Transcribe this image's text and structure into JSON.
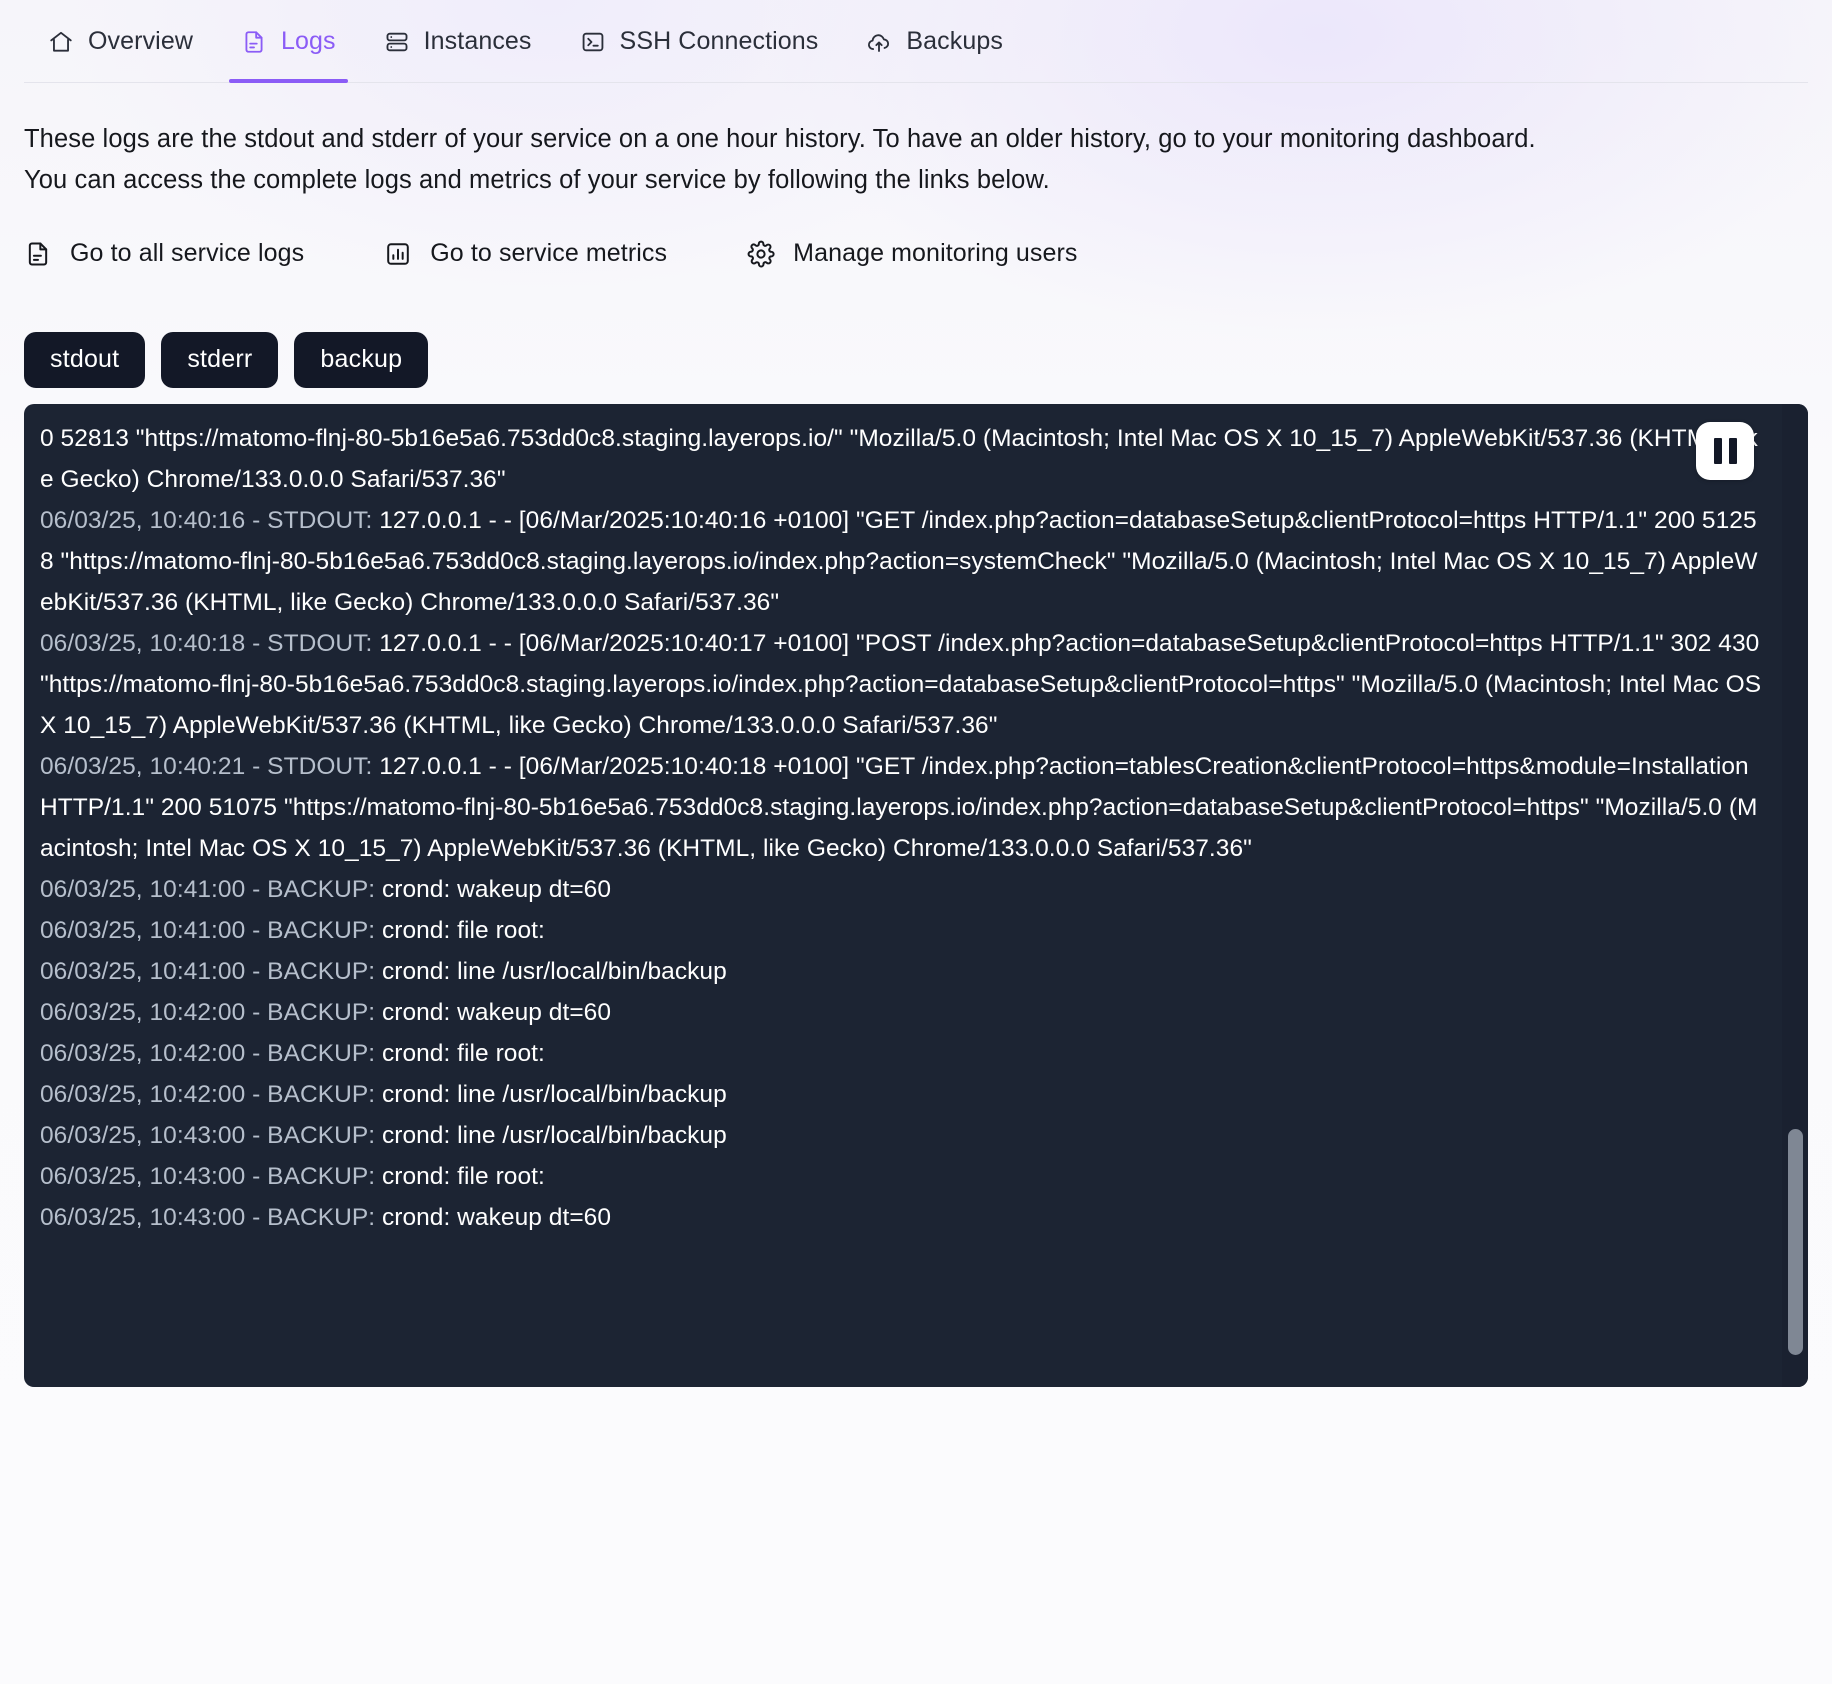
{
  "tabs": [
    {
      "label": "Overview",
      "icon": "home-icon",
      "active": false
    },
    {
      "label": "Logs",
      "icon": "file-text-icon",
      "active": true
    },
    {
      "label": "Instances",
      "icon": "database-icon",
      "active": false
    },
    {
      "label": "SSH Connections",
      "icon": "terminal-icon",
      "active": false
    },
    {
      "label": "Backups",
      "icon": "cloud-upload-icon",
      "active": false
    }
  ],
  "intro": {
    "line1": "These logs are the stdout and stderr of your service on a one hour history. To have an older history, go to your monitoring dashboard.",
    "line2": "You can access the complete logs and metrics of your service by following the links below."
  },
  "links": [
    {
      "label": "Go to all service logs",
      "icon": "file-text-icon"
    },
    {
      "label": "Go to service metrics",
      "icon": "bar-chart-icon"
    },
    {
      "label": "Manage monitoring users",
      "icon": "gear-icon"
    }
  ],
  "filters": [
    {
      "label": "stdout"
    },
    {
      "label": "stderr"
    },
    {
      "label": "backup"
    }
  ],
  "console": {
    "pause_label": "pause",
    "lines": [
      {
        "ts": "",
        "msg": "0 52813 \"https://matomo-flnj-80-5b16e5a6.753dd0c8.staging.layerops.io/\" \"Mozilla/5.0 (Macintosh; Intel Mac OS X 10_15_7) AppleWebKit/537.36 (KHTML, like Gecko) Chrome/133.0.0.0 Safari/537.36\""
      },
      {
        "ts": "06/03/25, 10:40:16 - STDOUT: ",
        "msg": "127.0.0.1 - - [06/Mar/2025:10:40:16 +0100] \"GET /index.php?action=databaseSetup&clientProtocol=https HTTP/1.1\" 200 51258 \"https://matomo-flnj-80-5b16e5a6.753dd0c8.staging.layerops.io/index.php?action=systemCheck\" \"Mozilla/5.0 (Macintosh; Intel Mac OS X 10_15_7) AppleWebKit/537.36 (KHTML, like Gecko) Chrome/133.0.0.0 Safari/537.36\""
      },
      {
        "ts": "06/03/25, 10:40:18 - STDOUT: ",
        "msg": "127.0.0.1 - - [06/Mar/2025:10:40:17 +0100] \"POST /index.php?action=databaseSetup&clientProtocol=https HTTP/1.1\" 302 430 \"https://matomo-flnj-80-5b16e5a6.753dd0c8.staging.layerops.io/index.php?action=databaseSetup&clientProtocol=https\" \"Mozilla/5.0 (Macintosh; Intel Mac OS X 10_15_7) AppleWebKit/537.36 (KHTML, like Gecko) Chrome/133.0.0.0 Safari/537.36\""
      },
      {
        "ts": "06/03/25, 10:40:21 - STDOUT: ",
        "msg": "127.0.0.1 - - [06/Mar/2025:10:40:18 +0100] \"GET /index.php?action=tablesCreation&clientProtocol=https&module=Installation HTTP/1.1\" 200 51075 \"https://matomo-flnj-80-5b16e5a6.753dd0c8.staging.layerops.io/index.php?action=databaseSetup&clientProtocol=https\" \"Mozilla/5.0 (Macintosh; Intel Mac OS X 10_15_7) AppleWebKit/537.36 (KHTML, like Gecko) Chrome/133.0.0.0 Safari/537.36\""
      },
      {
        "ts": "06/03/25, 10:41:00 - BACKUP: ",
        "msg": "crond: wakeup dt=60"
      },
      {
        "ts": "06/03/25, 10:41:00 - BACKUP: ",
        "msg": "crond: file root:"
      },
      {
        "ts": "06/03/25, 10:41:00 - BACKUP: ",
        "msg": "crond: line /usr/local/bin/backup"
      },
      {
        "ts": "06/03/25, 10:42:00 - BACKUP: ",
        "msg": "crond: wakeup dt=60"
      },
      {
        "ts": "06/03/25, 10:42:00 - BACKUP: ",
        "msg": "crond: file root:"
      },
      {
        "ts": "06/03/25, 10:42:00 - BACKUP: ",
        "msg": "crond: line /usr/local/bin/backup"
      },
      {
        "ts": "06/03/25, 10:43:00 - BACKUP: ",
        "msg": "crond: line /usr/local/bin/backup"
      },
      {
        "ts": "06/03/25, 10:43:00 - BACKUP: ",
        "msg": "crond: file root:"
      },
      {
        "ts": "06/03/25, 10:43:00 - BACKUP: ",
        "msg": "crond: wakeup dt=60"
      }
    ]
  },
  "colors": {
    "accent": "#8b5cf6",
    "console_bg": "#1c2433",
    "button_bg": "#131827",
    "timestamp": "#b6bfcc"
  }
}
